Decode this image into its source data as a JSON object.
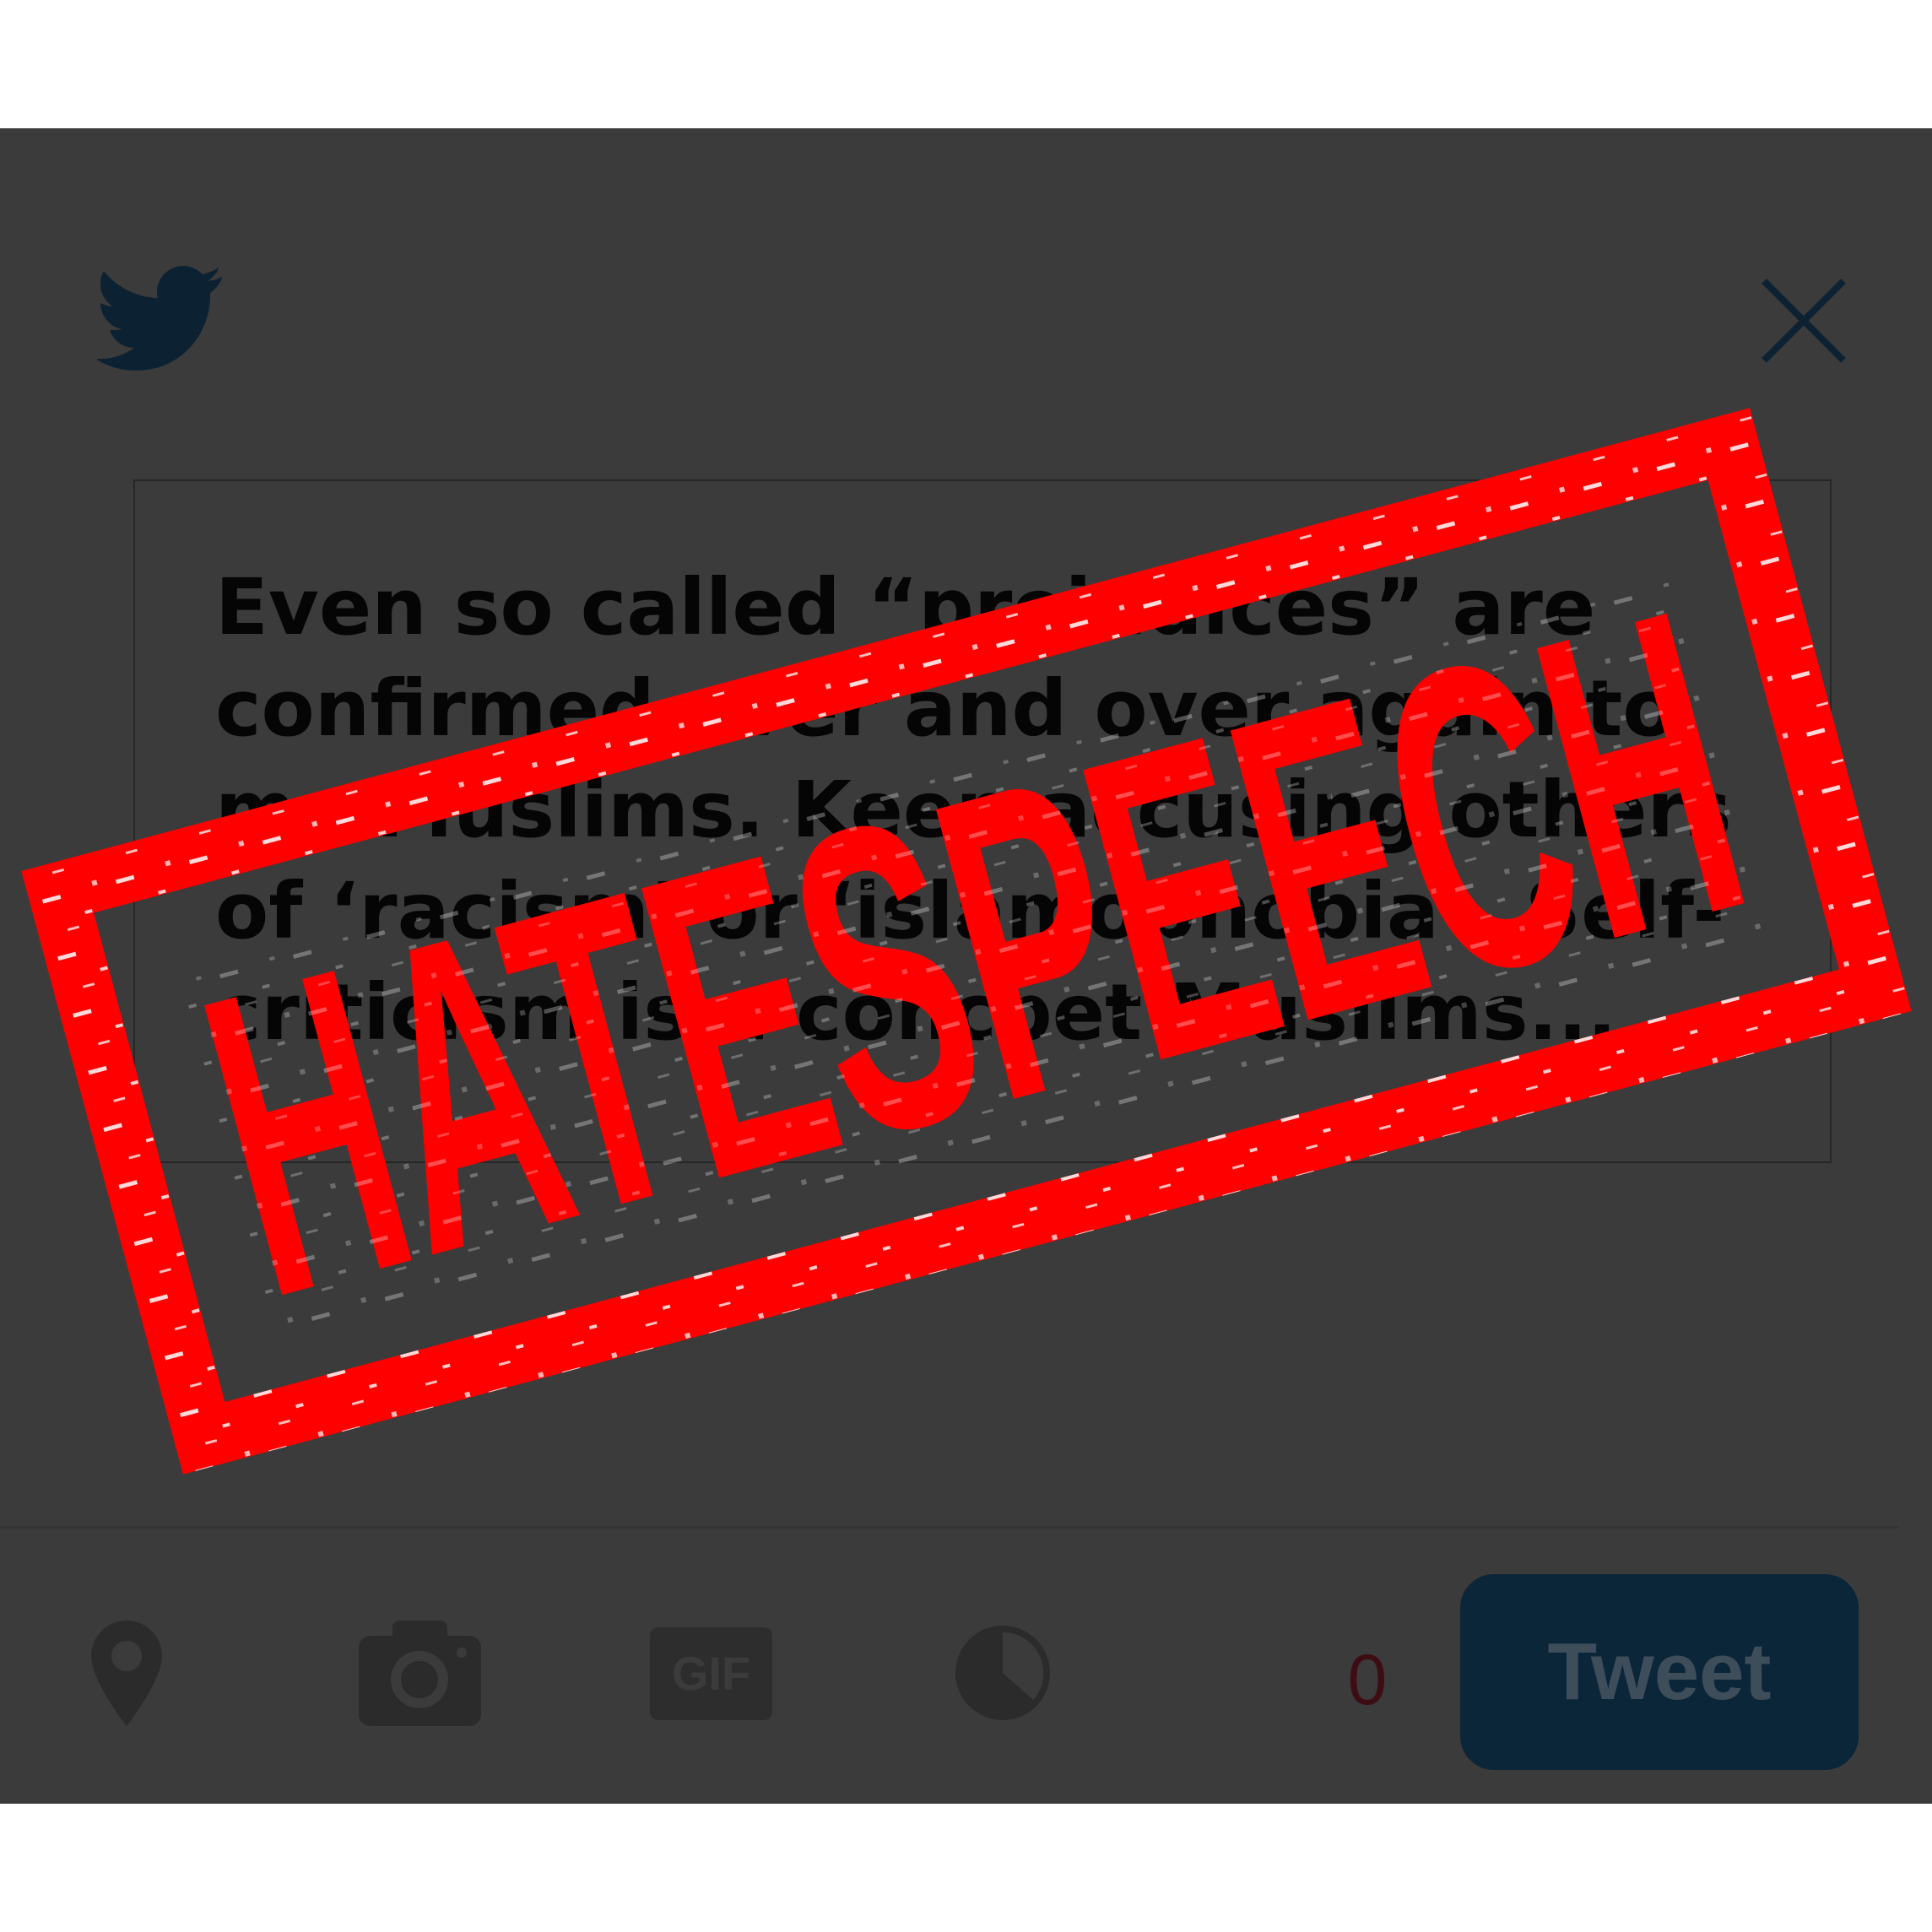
{
  "tweet": {
    "text": "Even so called “prejudices” are confirmed over and over again to me Muslims. Keep accusing others of ‘racism’ or ‘islamophobia’. Self-criticism is a concpet Muslims..."
  },
  "toolbar": {
    "gif_label": "GIF",
    "char_count": "0",
    "tweet_label": "Tweet"
  },
  "stamp": {
    "text": "HATESPEECH",
    "color": "#ff0000"
  },
  "colors": {
    "modal_bg": "#3b3b3b",
    "twitter_blue_dimmed": "#0b2638"
  },
  "icons": [
    "twitter-bird-icon",
    "close-icon",
    "location-pin-icon",
    "camera-icon",
    "poll-icon"
  ]
}
